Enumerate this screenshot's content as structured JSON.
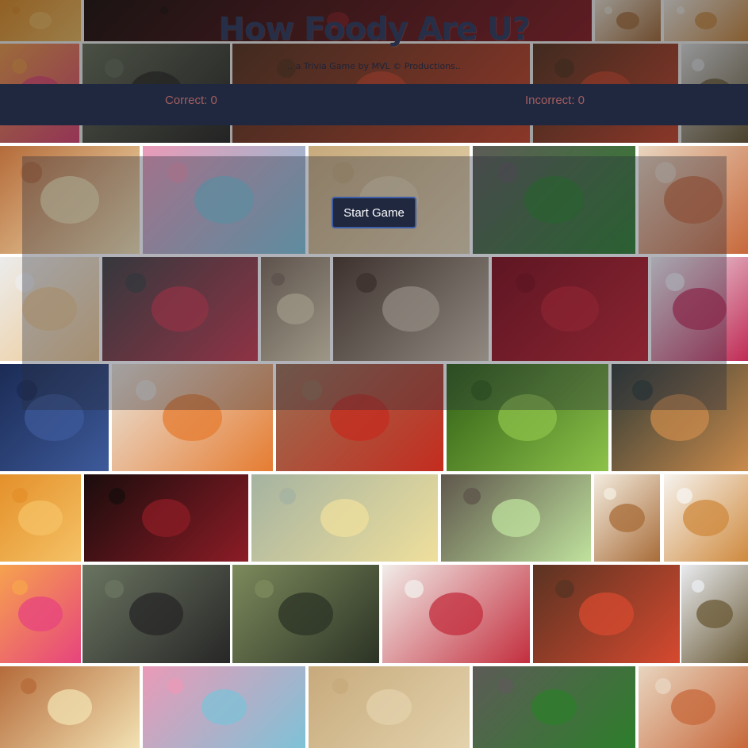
{
  "header": {
    "title": "How Foody Are U?",
    "subtitle": ".. a Trivia Game by MVL © Productions.."
  },
  "scoreboard": {
    "correct_label": "Correct: 0",
    "incorrect_label": "Incorrect: 0",
    "correct_count": 0,
    "incorrect_count": 0
  },
  "game": {
    "start_label": "Start Game"
  },
  "colors": {
    "navy_bar": "#202840",
    "score_text": "#a35e5e",
    "button_border": "#3e5ea7",
    "title_text": "#262f47"
  },
  "background": {
    "photos": [
      "oranges",
      "red-hands",
      "yogurt-parfait",
      "green-apples",
      "pancakes",
      "burger",
      "sprinkle-donut",
      "man-eating-burger",
      "field-worker",
      "wedding-cake",
      "spaghetti-bolognese",
      "plated-dish",
      "crepes",
      "marshmallow-cereal",
      "wheat",
      "basil-tomatoes",
      "club-sandwich",
      "cupcakes",
      "fruit-bowl",
      "cheese-board",
      "rillettes-toast",
      "cherries",
      "berry-pancakes",
      "blueberries",
      "sushi-rolls",
      "cherry-tomatoes",
      "green-chilies",
      "waffles"
    ]
  }
}
